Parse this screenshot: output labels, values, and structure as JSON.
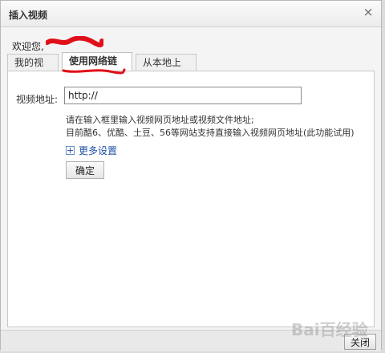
{
  "dialog": {
    "title": "插入视频",
    "close_symbol": "×"
  },
  "welcome": {
    "text": "欢迎您,"
  },
  "tabs": [
    {
      "label": "我的视频",
      "active": false
    },
    {
      "label": "使用网络链接",
      "active": true
    },
    {
      "label": "从本地上传",
      "active": false
    }
  ],
  "form": {
    "url_label": "视频地址:",
    "url_value": "http://",
    "hint_line1": "请在输入框里输入视频网页地址或视频文件地址;",
    "hint_line2": "目前酷6、优酷、土豆、56等网站支持直接输入视频网页地址(此功能试用)",
    "more_settings": "更多设置",
    "confirm_label": "确定"
  },
  "footer": {
    "close_label": "关闭"
  },
  "watermark": "Bai百经验",
  "colors": {
    "redaction": "#e0101a",
    "link": "#1d4fa3"
  },
  "icons": {
    "dialog_close": "close-icon",
    "more_settings": "plus-box-icon"
  }
}
